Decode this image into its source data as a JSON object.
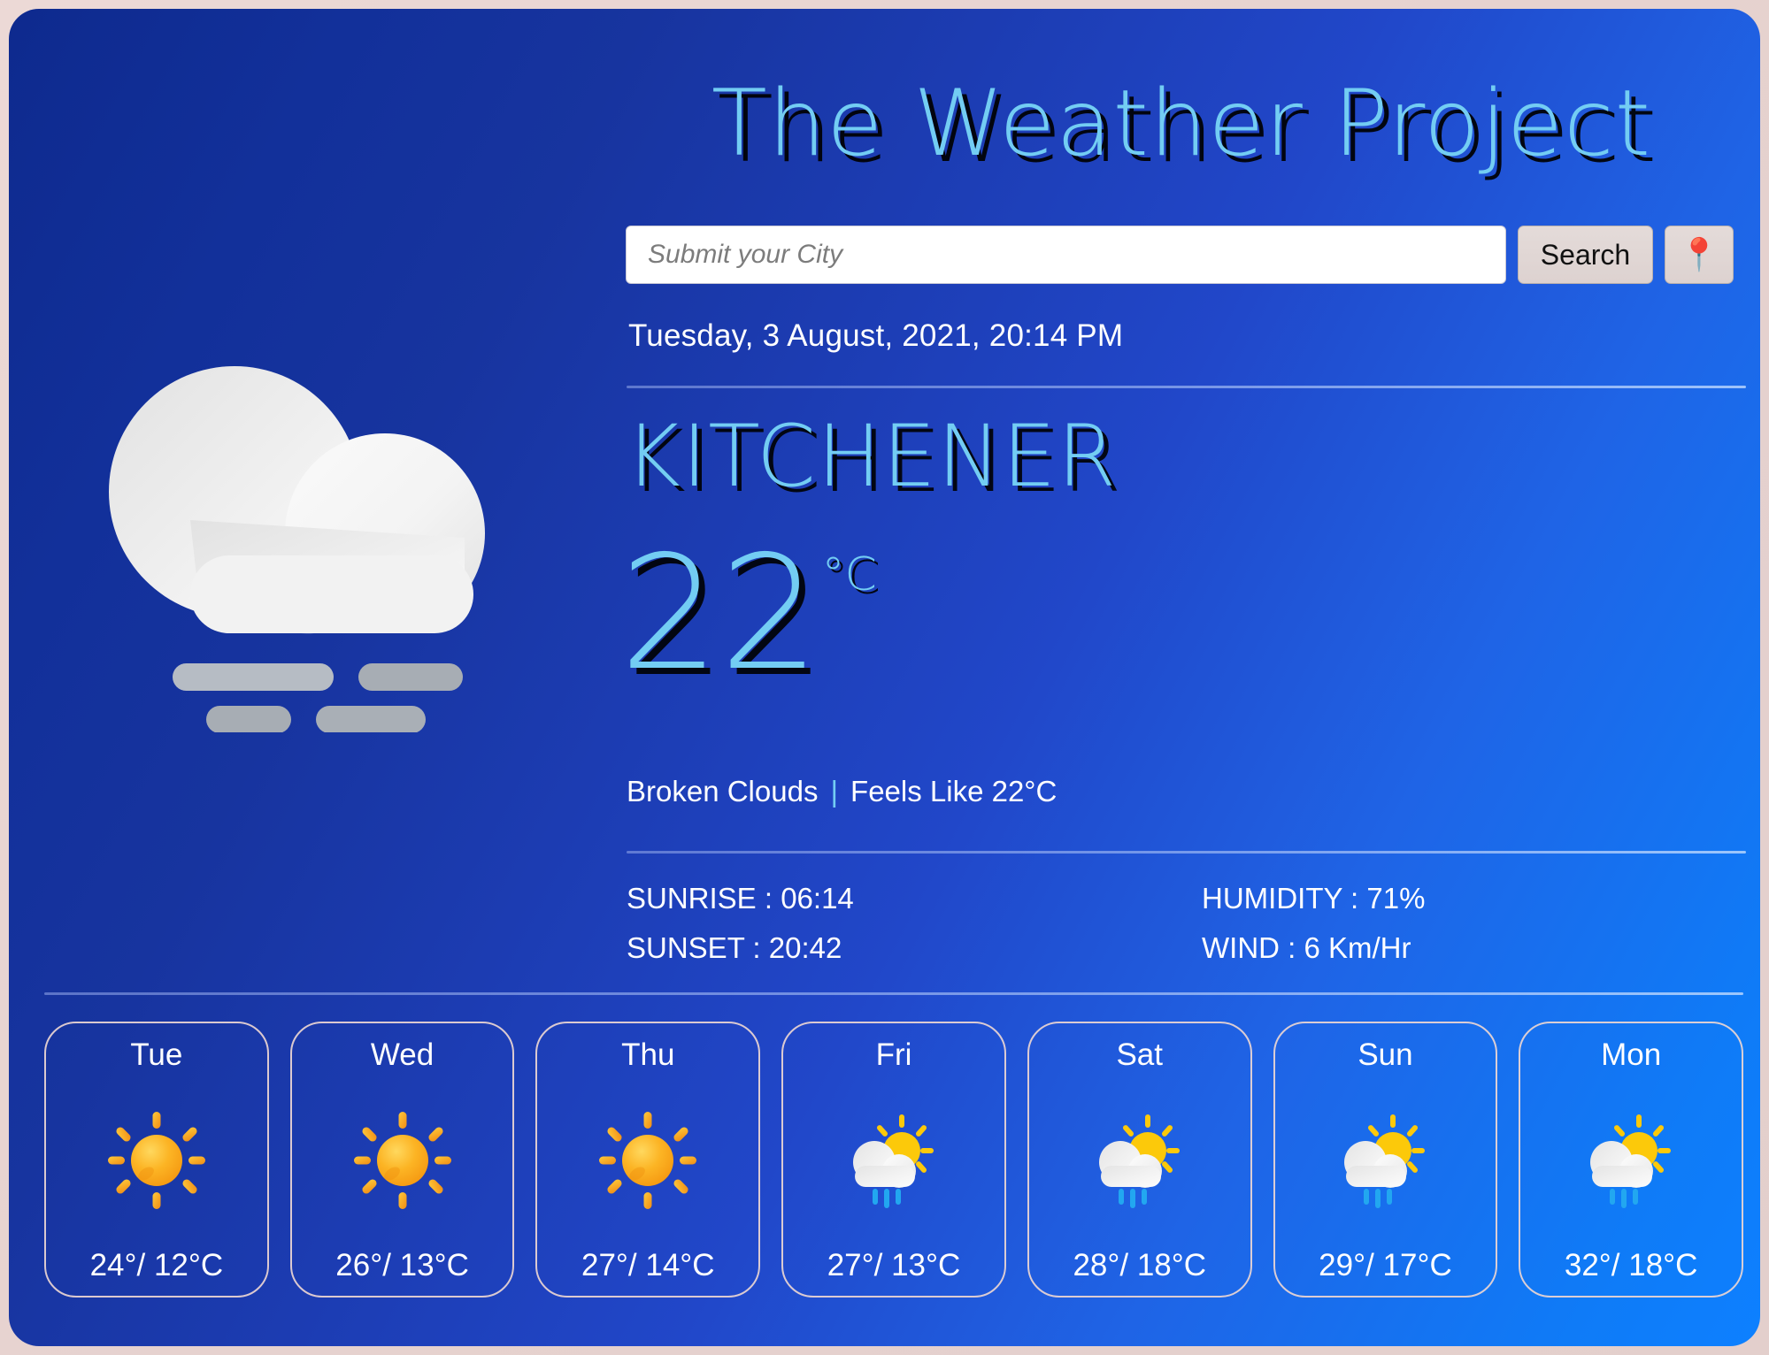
{
  "app": {
    "title": "The Weather Project",
    "accent_color": "#73cdf3",
    "background_from": "#0e2a8e",
    "background_to": "#0d80ff",
    "frame_color": "#e8d5d2"
  },
  "search": {
    "placeholder": "Submit your City",
    "value": "",
    "search_label": "Search",
    "locate_icon": "📍"
  },
  "current": {
    "datetime": "Tuesday, 3 August, 2021, 20:14 PM",
    "city": "KITCHENER",
    "temperature": "22",
    "unit": "°C",
    "condition": "Broken Clouds",
    "separator": "|",
    "feels_like": "Feels Like 22°C",
    "icon": "broken-clouds-mist-icon"
  },
  "stats": {
    "sunrise": "SUNRISE : 06:14",
    "sunset": "SUNSET : 20:42",
    "humidity": "HUMIDITY : 71%",
    "wind": "WIND : 6 Km/Hr"
  },
  "forecast": [
    {
      "day": "Tue",
      "icon": "sun-icon",
      "temps": "24°/ 12°C",
      "high": 24,
      "low": 12
    },
    {
      "day": "Wed",
      "icon": "sun-icon",
      "temps": "26°/ 13°C",
      "high": 26,
      "low": 13
    },
    {
      "day": "Thu",
      "icon": "sun-icon",
      "temps": "27°/ 14°C",
      "high": 27,
      "low": 14
    },
    {
      "day": "Fri",
      "icon": "sun-rain-cloud-icon",
      "temps": "27°/ 13°C",
      "high": 27,
      "low": 13
    },
    {
      "day": "Sat",
      "icon": "sun-rain-cloud-icon",
      "temps": "28°/ 18°C",
      "high": 28,
      "low": 18
    },
    {
      "day": "Sun",
      "icon": "sun-rain-cloud-icon",
      "temps": "29°/ 17°C",
      "high": 29,
      "low": 17
    },
    {
      "day": "Mon",
      "icon": "sun-rain-cloud-icon",
      "temps": "32°/ 18°C",
      "high": 32,
      "low": 18
    }
  ]
}
